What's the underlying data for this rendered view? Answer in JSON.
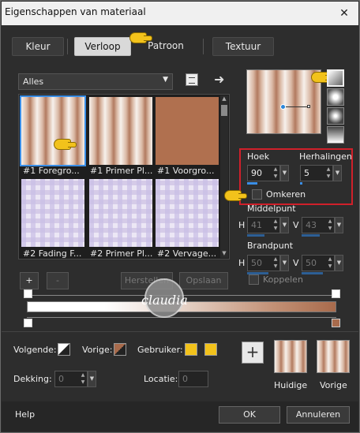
{
  "window": {
    "title": "Eigenschappen van materiaal",
    "close_icon": "close-icon"
  },
  "tabs": [
    {
      "label": "Kleur",
      "active": false
    },
    {
      "label": "Verloop",
      "active": true
    },
    {
      "label": "Patroon",
      "active": false
    },
    {
      "label": "Textuur",
      "active": false
    }
  ],
  "library": {
    "selected": "Alles"
  },
  "gallery": {
    "items": [
      {
        "label": "#1 Foregro...",
        "style": "stripes",
        "selected": true
      },
      {
        "label": "#1 Primer Pl...",
        "style": "stripes",
        "selected": false
      },
      {
        "label": "#1 Voorgro...",
        "style": "solid",
        "selected": false
      },
      {
        "label": "#2 Fading F...",
        "style": "check",
        "selected": false
      },
      {
        "label": "#2 Primer Pl...",
        "style": "check",
        "selected": false
      },
      {
        "label": "#2 Vervage...",
        "style": "check",
        "selected": false
      }
    ]
  },
  "left_buttons": {
    "add": "+",
    "remove": "-",
    "restore": "Herstellen",
    "save": "Opslaan"
  },
  "style_buttons": [
    "linear-gradient-icon",
    "rectangular-gradient-icon",
    "radial-gradient-icon",
    "sunburst-gradient-icon"
  ],
  "gradient": {
    "hoek_label": "Hoek",
    "hoek_value": "90",
    "herhalingen_label": "Herhalingen",
    "herhalingen_value": "5",
    "omkeren_label": "Omkeren",
    "omkeren_checked": false,
    "middelpunt_label": "Middelpunt",
    "mid_h_label": "H",
    "mid_h_value": "41",
    "mid_v_label": "V",
    "mid_v_value": "43",
    "brandpunt_label": "Brandpunt",
    "brand_h_label": "H",
    "brand_h_value": "50",
    "brand_v_label": "V",
    "brand_v_value": "50",
    "koppelen_label": "Koppelen",
    "hoek_fill": 0.25,
    "herhalingen_fill": 0.05,
    "mid_h_fill": 0.41,
    "mid_v_fill": 0.43,
    "brand_h_fill": 0.5,
    "brand_v_fill": 0.5
  },
  "bottom": {
    "volgende_label": "Volgende:",
    "vorige_label": "Vorige:",
    "gebruiker_label": "Gebruiker:",
    "dekking_label": "Dekking:",
    "dekking_value": "0",
    "locatie_label": "Locatie:",
    "locatie_value": "0",
    "huidige_label": "Huidige",
    "vorige2_label": "Vorige",
    "user_color": "#f2c21b",
    "brown_color": "#a86b4c"
  },
  "watermark": "claudia",
  "footer": {
    "help": "Help",
    "ok": "OK",
    "cancel": "Annuleren"
  }
}
